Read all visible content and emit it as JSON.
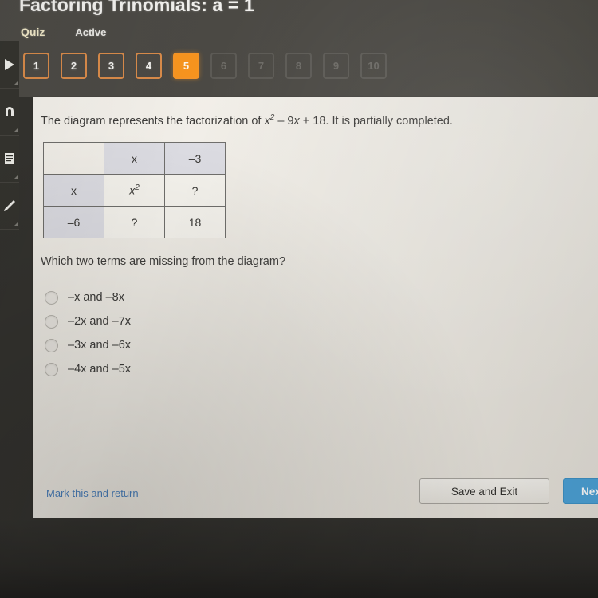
{
  "header": {
    "title": "Factoring Trinomials: a = 1",
    "activity_type": "Quiz",
    "activity_state": "Active"
  },
  "pager": {
    "items": [
      {
        "label": "1",
        "state": "done"
      },
      {
        "label": "2",
        "state": "done"
      },
      {
        "label": "3",
        "state": "done"
      },
      {
        "label": "4",
        "state": "done"
      },
      {
        "label": "5",
        "state": "current"
      },
      {
        "label": "6",
        "state": "locked"
      },
      {
        "label": "7",
        "state": "locked"
      },
      {
        "label": "8",
        "state": "locked"
      },
      {
        "label": "9",
        "state": "locked"
      },
      {
        "label": "10",
        "state": "locked"
      }
    ],
    "accent_color": "#f7941e",
    "locked_color": "#6d6b66"
  },
  "sidebar": {
    "icons": [
      {
        "name": "play-arrow-icon"
      },
      {
        "name": "magnet-icon"
      },
      {
        "name": "document-icon"
      },
      {
        "name": "pencil-icon"
      }
    ]
  },
  "question": {
    "stem_before": "The diagram represents the factorization of ",
    "stem_expression_base": "x",
    "stem_expression_exp": "2",
    "stem_expression_rest": " – 9x + 18",
    "stem_after": ". It is partially completed.",
    "prompt": "Which two terms are missing from the diagram?"
  },
  "diagram": {
    "column_headers": [
      "x",
      "–3"
    ],
    "rows": [
      {
        "row_header": "x",
        "cells": [
          "x²",
          "?"
        ]
      },
      {
        "row_header": "–6",
        "cells": [
          "?",
          "18"
        ]
      }
    ],
    "header_fill": "#dcdce2",
    "body_fill": "#f4f2ec"
  },
  "options": [
    {
      "label": "–x and –8x",
      "selected": false
    },
    {
      "label": "–2x and –7x",
      "selected": false
    },
    {
      "label": "–3x and –6x",
      "selected": false
    },
    {
      "label": "–4x and –5x",
      "selected": false
    }
  ],
  "footer": {
    "mark_return_label": "Mark this and return",
    "save_exit_label": "Save and Exit",
    "next_label": "Next",
    "link_color": "#4a7fbb",
    "next_color": "#4da3d8"
  }
}
